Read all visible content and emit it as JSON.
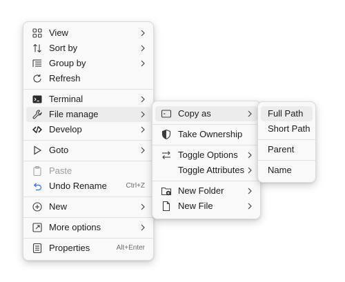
{
  "main_menu": {
    "view": "View",
    "sort_by": "Sort by",
    "group_by": "Group by",
    "refresh": "Refresh",
    "terminal": "Terminal",
    "file_manage": "File manage",
    "develop": "Develop",
    "goto": "Goto",
    "paste": "Paste",
    "undo_rename": "Undo Rename",
    "undo_rename_shortcut": "Ctrl+Z",
    "new": "New",
    "more_options": "More options",
    "properties": "Properties",
    "properties_shortcut": "Alt+Enter"
  },
  "file_manage_menu": {
    "copy_as": "Copy as",
    "take_ownership": "Take Ownership",
    "toggle_options": "Toggle Options",
    "toggle_attributes": "Toggle Attributes",
    "new_folder": "New Folder",
    "new_file": "New File"
  },
  "copy_as_menu": {
    "full_path": "Full Path",
    "short_path": "Short Path",
    "parent": "Parent",
    "name": "Name"
  },
  "colors": {
    "menu_bg": "#f9f9f9",
    "hover_bg": "#ececec",
    "disabled_text": "#9d9d9d",
    "border": "#dcdcdc"
  }
}
